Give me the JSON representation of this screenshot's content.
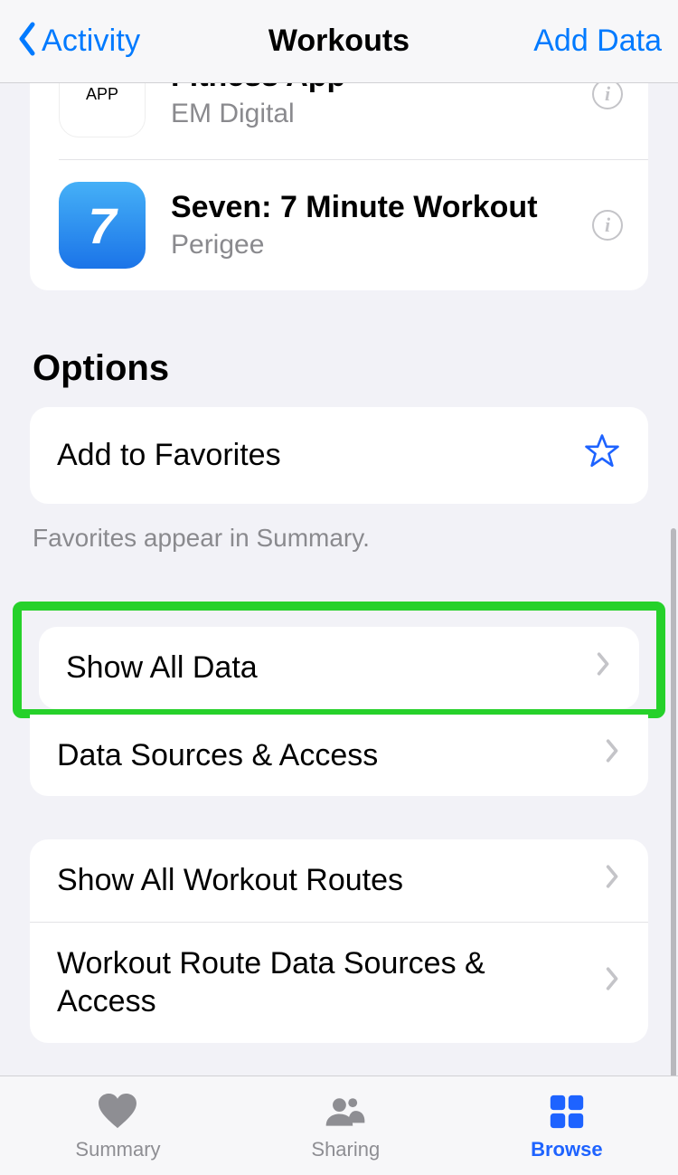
{
  "nav": {
    "back_label": "Activity",
    "title": "Workouts",
    "right_label": "Add Data"
  },
  "apps": {
    "items": [
      {
        "icon_text": "APP",
        "title": "Fitness App",
        "vendor": "EM Digital"
      },
      {
        "icon_text": "7",
        "title": "Seven: 7 Minute Workout",
        "vendor": "Perigee"
      }
    ]
  },
  "options": {
    "section_title": "Options",
    "favorites_label": "Add to Favorites",
    "footnote": "Favorites appear in Summary."
  },
  "data_list": {
    "show_all_data": "Show All Data",
    "sources_access": "Data Sources & Access"
  },
  "routes": {
    "show_all_routes": "Show All Workout Routes",
    "route_sources": "Workout Route Data Sources & Access"
  },
  "tabs": {
    "summary": "Summary",
    "sharing": "Sharing",
    "browse": "Browse"
  }
}
